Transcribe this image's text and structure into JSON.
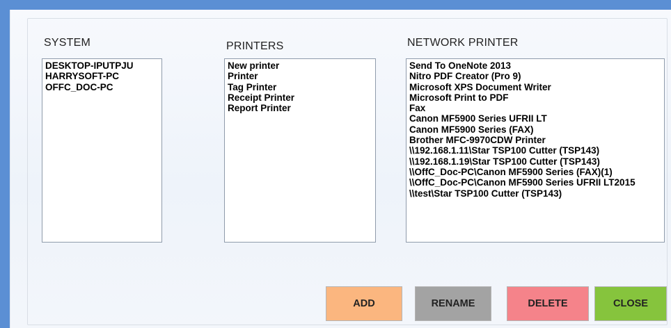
{
  "sections": {
    "system": {
      "label": "SYSTEM",
      "items": [
        "DESKTOP-IPUTPJU",
        "HARRYSOFT-PC",
        "OFFC_DOC-PC"
      ]
    },
    "printers": {
      "label": "PRINTERS",
      "items": [
        "New printer",
        "Printer",
        "Tag Printer",
        "Receipt Printer",
        "Report Printer"
      ]
    },
    "network": {
      "label": "NETWORK PRINTER",
      "items": [
        "Send To OneNote 2013",
        "Nitro PDF Creator (Pro 9)",
        "Microsoft XPS Document Writer",
        "Microsoft Print to PDF",
        "Fax",
        "Canon MF5900 Series UFRII LT",
        "Canon MF5900 Series (FAX)",
        "Brother MFC-9970CDW Printer",
        "\\\\192.168.1.11\\Star TSP100 Cutter (TSP143)",
        "\\\\192.168.1.19\\Star TSP100 Cutter (TSP143)",
        "\\\\OffC_Doc-PC\\Canon MF5900 Series (FAX)(1)",
        "\\\\OffC_Doc-PC\\Canon MF5900 Series UFRII LT2015",
        "\\\\test\\Star TSP100 Cutter (TSP143)"
      ]
    }
  },
  "buttons": {
    "add": {
      "label": "ADD",
      "color": "#fbb67f"
    },
    "rename": {
      "label": "RENAME",
      "color": "#a3a3a3"
    },
    "delete": {
      "label": "DELETE",
      "color": "#f5838a"
    },
    "close": {
      "label": "CLOSE",
      "color": "#86c43d"
    }
  },
  "colors": {
    "background": "#5b8fd4"
  }
}
